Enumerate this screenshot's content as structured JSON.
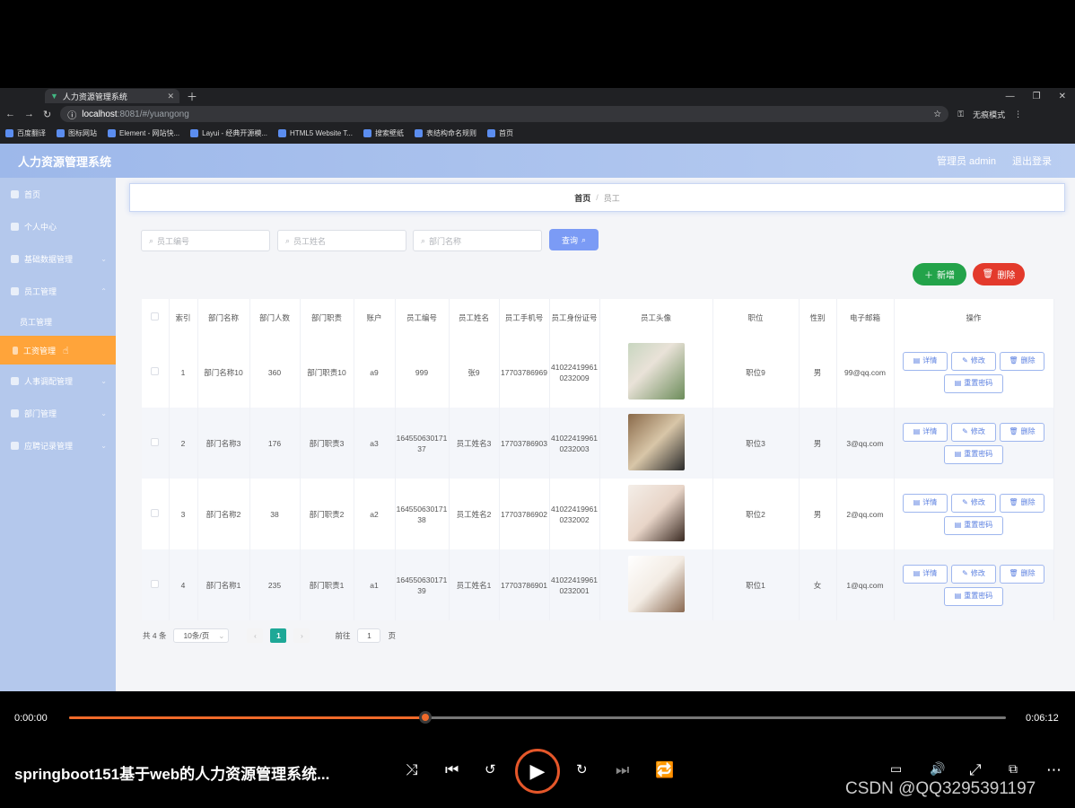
{
  "browser": {
    "tab_title": "人力资源管理系统",
    "url_host": "localhost",
    "url_rest": ":8081/#/yuangong",
    "profile": "无痕模式",
    "bookmarks": [
      "百度翻译",
      "图标网站",
      "Element - 网站快...",
      "Layui - 经典开源模...",
      "HTML5 Website T...",
      "搜索壁纸",
      "表结构命名规则",
      "首页"
    ]
  },
  "header": {
    "title": "人力资源管理系统",
    "user": "管理员 admin",
    "logout": "退出登录"
  },
  "sidebar": {
    "items": [
      {
        "label": "首页"
      },
      {
        "label": "个人中心"
      },
      {
        "label": "基础数据管理"
      },
      {
        "label": "员工管理"
      }
    ],
    "sub1": "员工管理",
    "sub2": "工资管理",
    "items2": [
      {
        "label": "人事调配管理"
      },
      {
        "label": "部门管理"
      },
      {
        "label": "应聘记录管理"
      }
    ]
  },
  "breadcrumb": {
    "home": "首页",
    "sep": "/",
    "current": "员工"
  },
  "search": {
    "p1": "员工编号",
    "p2": "员工姓名",
    "p3": "部门名称",
    "query": "查询"
  },
  "actions": {
    "add": "新增",
    "delete": "删除"
  },
  "table": {
    "headers": [
      "索引",
      "部门名称",
      "部门人数",
      "部门职责",
      "账户",
      "员工编号",
      "员工姓名",
      "员工手机号",
      "员工身份证号",
      "员工头像",
      "职位",
      "性别",
      "电子邮箱",
      "操作"
    ],
    "rows": [
      {
        "idx": "1",
        "dept": "部门名称10",
        "num": "360",
        "duty": "部门职责10",
        "acct": "a9",
        "no": "999",
        "name": "张9",
        "phone": "17703786969",
        "id": "410224199610232009",
        "pos": "职位9",
        "sex": "男",
        "email": "99@qq.com"
      },
      {
        "idx": "2",
        "dept": "部门名称3",
        "num": "176",
        "duty": "部门职责3",
        "acct": "a3",
        "no": "16455063017137",
        "name": "员工姓名3",
        "phone": "17703786903",
        "id": "410224199610232003",
        "pos": "职位3",
        "sex": "男",
        "email": "3@qq.com"
      },
      {
        "idx": "3",
        "dept": "部门名称2",
        "num": "38",
        "duty": "部门职责2",
        "acct": "a2",
        "no": "16455063017138",
        "name": "员工姓名2",
        "phone": "17703786902",
        "id": "410224199610232002",
        "pos": "职位2",
        "sex": "男",
        "email": "2@qq.com"
      },
      {
        "idx": "4",
        "dept": "部门名称1",
        "num": "235",
        "duty": "部门职责1",
        "acct": "a1",
        "no": "16455063017139",
        "name": "员工姓名1",
        "phone": "17703786901",
        "id": "410224199610232001",
        "pos": "职位1",
        "sex": "女",
        "email": "1@qq.com"
      }
    ],
    "ops": {
      "detail": "详情",
      "edit": "修改",
      "del": "删除",
      "reset": "重置密码"
    }
  },
  "pager": {
    "total": "共 4 条",
    "size": "10条/页",
    "page": "1",
    "goto": "前往",
    "goto_val": "1",
    "unit": "页"
  },
  "player": {
    "elapsed": "0:00:00",
    "duration": "0:06:12",
    "progress": 0.38,
    "title": "springboot151基于web的人力资源管理系统...",
    "watermark": "CSDN @QQ3295391197"
  },
  "colors": {
    "accent": "#ffa43a",
    "header": "#9db8ea",
    "progress": "#f06a2a"
  }
}
